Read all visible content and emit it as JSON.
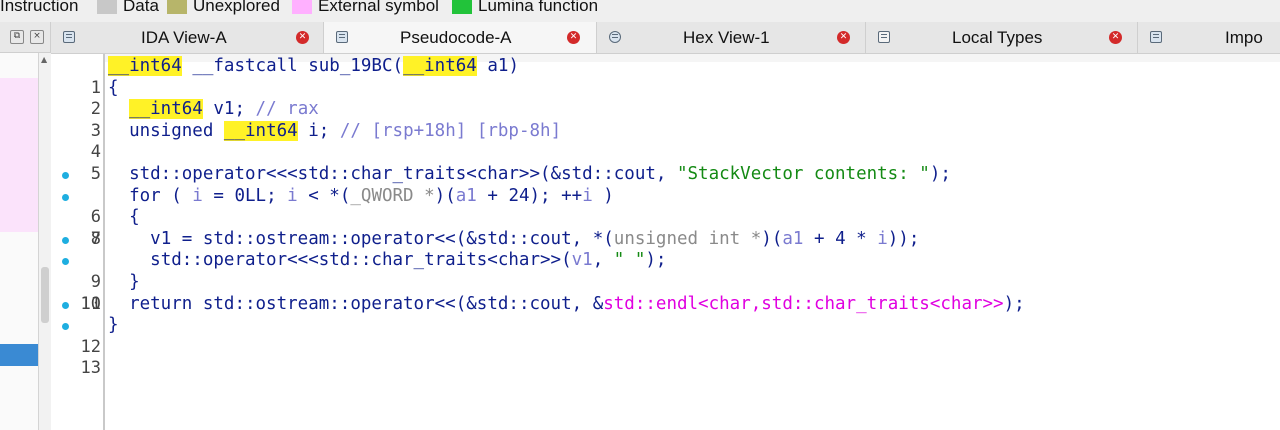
{
  "legend": [
    {
      "label": "Instruction",
      "color": "#efefef"
    },
    {
      "label": "Data",
      "color": "#c8c8c8"
    },
    {
      "label": "Unexplored",
      "color": "#b7b56a"
    },
    {
      "label": "External symbol",
      "color": "#ffb0ff"
    },
    {
      "label": "Lumina function",
      "color": "#22c33a"
    }
  ],
  "tabs": [
    {
      "label": "IDA View-A",
      "icon": "ida-view-icon",
      "active": false
    },
    {
      "label": "Pseudocode-A",
      "icon": "pseudocode-icon",
      "active": true
    },
    {
      "label": "Hex View-1",
      "icon": "hex-view-icon",
      "active": false
    },
    {
      "label": "Local Types",
      "icon": "local-types-icon",
      "active": false
    },
    {
      "label": "Impo",
      "icon": "imports-icon",
      "active": false
    }
  ],
  "colors": {
    "keyword": "#0f1f8c",
    "variable": "#7a7ad0",
    "string": "#148a14",
    "external": "#e000e0",
    "highlight": "#fff227",
    "breakpoint_dot": "#1eaee0",
    "close_button": "#d32a2a"
  },
  "code": {
    "lines": [
      {
        "n": "1",
        "dot": false
      },
      {
        "n": "2",
        "dot": false
      },
      {
        "n": "3",
        "dot": false
      },
      {
        "n": "4",
        "dot": false
      },
      {
        "n": "5",
        "dot": false
      },
      {
        "n": "6",
        "dot": true
      },
      {
        "n": "7",
        "dot": true
      },
      {
        "n": "8",
        "dot": false
      },
      {
        "n": "9",
        "dot": true
      },
      {
        "n": "10",
        "dot": true
      },
      {
        "n": "11",
        "dot": false
      },
      {
        "n": "12",
        "dot": true
      },
      {
        "n": "13",
        "dot": true
      }
    ],
    "tokens": {
      "int64": "__int64",
      "fastcall": "__fastcall",
      "func_name": "sub_19BC",
      "a1": "a1",
      "open_brace": "{",
      "close_brace": "}",
      "v1": "v1",
      "rax_comment": "// rax",
      "unsigned": "unsigned",
      "i": "i",
      "stack_comment": "// [rsp+18h] [rbp-8h]",
      "op_char_traits": "std::operator<<<std::char_traits<char>>",
      "cout": "&std::cout",
      "str_contents": "\"StackVector contents: \"",
      "for_kw": "for",
      "zero_ll": "0LL",
      "qword_cast": "_QWORD *",
      "num_24": "24",
      "ostream_op": "std::ostream::operator<<",
      "uint_ptr": "unsigned int *",
      "num_4": "4",
      "str_space": "\" \"",
      "return_kw": "return",
      "endl": "std::endl<char,std::char_traits<char>>"
    }
  }
}
